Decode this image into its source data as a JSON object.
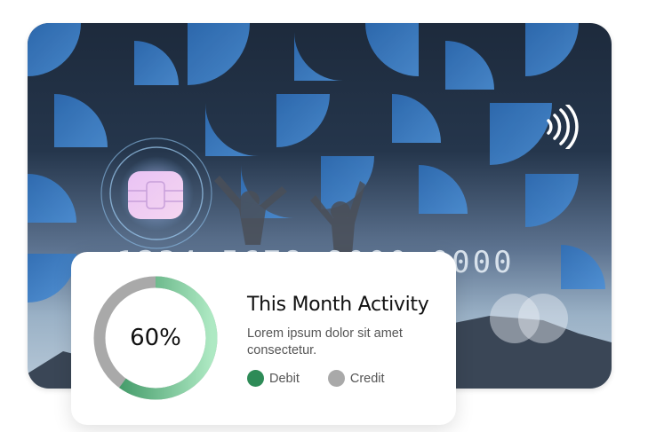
{
  "card": {
    "number_groups": [
      "1234",
      "5678",
      "9000",
      "0000"
    ]
  },
  "activity": {
    "percent_label": "60%",
    "progress": 0.6,
    "title": "This Month Activity",
    "description": "Lorem ipsum dolor sit amet consectetur.",
    "legend": [
      {
        "label": "Debit",
        "color": "#2e8b57"
      },
      {
        "label": "Credit",
        "color": "#a9a9a9"
      }
    ]
  }
}
